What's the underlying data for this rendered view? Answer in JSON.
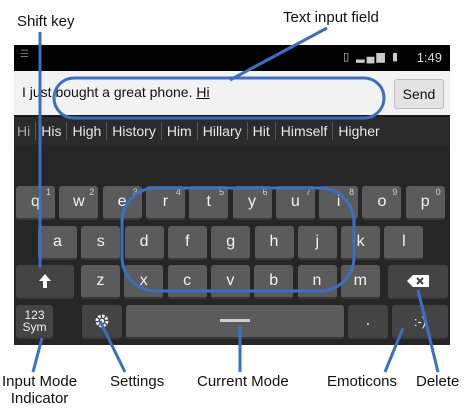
{
  "callouts": {
    "shift_key": "Shift key",
    "text_input_field": "Text input field",
    "input_mode_indicator": "Input Mode\nIndicator",
    "settings": "Settings",
    "current_mode": "Current Mode",
    "emoticons": "Emoticons",
    "delete": "Delete"
  },
  "status_bar": {
    "time": "1:49",
    "icons": "icon-vibrate icon-signal icon-battery"
  },
  "input": {
    "text": "I just bought a great phone. ",
    "current_word": "Hi",
    "send_label": "Send"
  },
  "suggestions": [
    "Hi",
    "His",
    "High",
    "History",
    "Him",
    "Hillary",
    "Hit",
    "Himself",
    "Higher"
  ],
  "keyboard": {
    "row1": [
      {
        "label": "q",
        "sub": "1"
      },
      {
        "label": "w",
        "sub": "2"
      },
      {
        "label": "e",
        "sub": "3"
      },
      {
        "label": "r",
        "sub": "4"
      },
      {
        "label": "t",
        "sub": "5"
      },
      {
        "label": "y",
        "sub": "6"
      },
      {
        "label": "u",
        "sub": "7"
      },
      {
        "label": "i",
        "sub": "8"
      },
      {
        "label": "o",
        "sub": "9"
      },
      {
        "label": "p",
        "sub": "0"
      }
    ],
    "row2": [
      "a",
      "s",
      "d",
      "f",
      "g",
      "h",
      "j",
      "k",
      "l"
    ],
    "row3": [
      "z",
      "x",
      "c",
      "v",
      "b",
      "n",
      "m"
    ],
    "shift_icon": "up-arrow-icon",
    "delete_icon": "backspace-icon",
    "mode_label": "123\nSym",
    "settings_icon": "gear-icon",
    "period_label": ".",
    "emoticon_label": ":-)",
    "highlight_color": "#3b6fc6"
  }
}
